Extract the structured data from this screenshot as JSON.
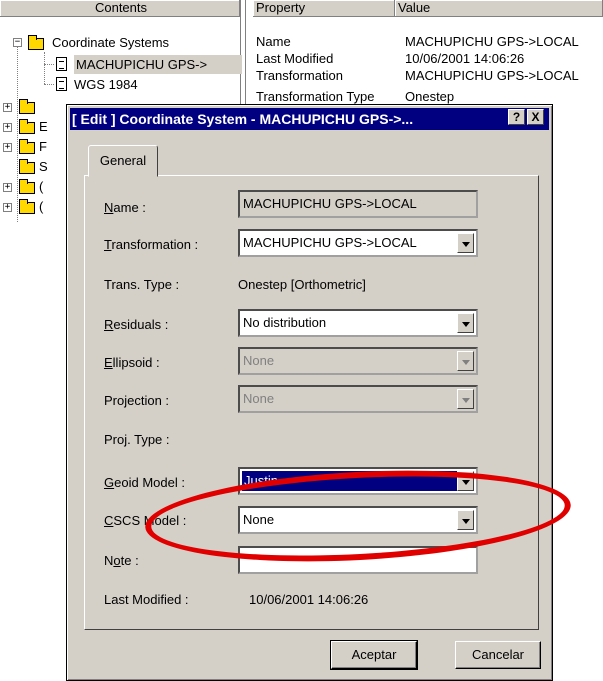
{
  "headers": {
    "contents": "Contents",
    "property": "Property",
    "value": "Value"
  },
  "tree": {
    "root_label": "Coordinate Systems",
    "items": [
      "MACHUPICHU GPS->",
      "WGS 1984"
    ],
    "truncated": [
      "",
      "E",
      "F",
      "S",
      "(",
      "("
    ]
  },
  "properties": [
    {
      "name": "Name",
      "value": "MACHUPICHU GPS->LOCAL"
    },
    {
      "name": "Last Modified",
      "value": "10/06/2001 14:06:26"
    },
    {
      "name": "Transformation",
      "value": "MACHUPICHU GPS->LOCAL"
    },
    {
      "name": "Transformation Type",
      "value": "Onestep"
    }
  ],
  "dialog": {
    "title": "[ Edit ] Coordinate System - MACHUPICHU GPS->...",
    "help_btn": "?",
    "close_btn": "X",
    "tab": "General",
    "fields": {
      "name": {
        "label": "Name :",
        "value": "MACHUPICHU GPS->LOCAL"
      },
      "transformation": {
        "label": "Transformation :",
        "value": "MACHUPICHU GPS->LOCAL"
      },
      "trans_type": {
        "label": "Trans. Type :",
        "value": "Onestep [Orthometric]"
      },
      "residuals": {
        "label": "Residuals :",
        "value": "No distribution"
      },
      "ellipsoid": {
        "label": "Ellipsoid :",
        "value": "None"
      },
      "projection": {
        "label": "Projection :",
        "value": "None"
      },
      "proj_type": {
        "label": "Proj. Type :",
        "value": ""
      },
      "geoid_model": {
        "label": "Geoid Model :",
        "value": "Justin"
      },
      "cscs_model": {
        "label": "CSCS Model :",
        "value": "None"
      },
      "note": {
        "label": "Note :",
        "value": ""
      },
      "last_modified": {
        "label": "Last Modified :",
        "value": "10/06/2001 14:06:26"
      }
    },
    "ok_button": "Aceptar",
    "cancel_button": "Cancelar"
  },
  "colors": {
    "highlight": "#000080",
    "annotation_circle": "#e00000",
    "window_face": "#d4d0c8"
  }
}
